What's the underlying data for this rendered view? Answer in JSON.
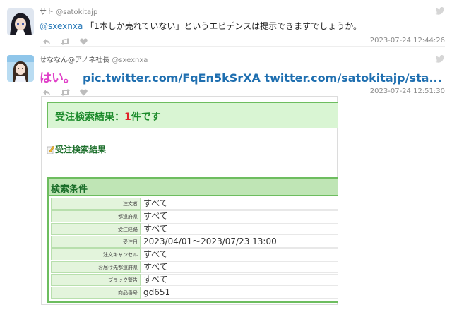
{
  "tweets": [
    {
      "display_name": "サト",
      "handle": "@satokitajp",
      "mention": "@sxexnxa",
      "text": " 「1本しか売れていない」というエビデンスは提示できますでしょうか。",
      "timestamp": "2023-07-24 12:44:26"
    },
    {
      "display_name": "せななん@アノネ社長",
      "handle": "@sxexnxa",
      "text_lead": "はい。",
      "links": "pic.twitter.com/FqEn5kSrXA twitter.com/satokitajp/sta...",
      "timestamp": "2023-07-24 12:51:30"
    }
  ],
  "embedded": {
    "banner_prefix": "受注検索結果：",
    "banner_count": "1",
    "banner_suffix": "件です",
    "subheading": "受注検索結果",
    "conditions_title": "検索条件",
    "rows": [
      {
        "label": "注文者",
        "value": "すべて"
      },
      {
        "label": "都道府県",
        "value": "すべて"
      },
      {
        "label": "受注経路",
        "value": "すべて"
      },
      {
        "label": "受注日",
        "value": "2023/04/01～2023/07/23 13:00"
      },
      {
        "label": "注文キャンセル",
        "value": "すべて"
      },
      {
        "label": "お届け先都道府県",
        "value": "すべて"
      },
      {
        "label": "ブラック警告",
        "value": "すべて"
      },
      {
        "label": "商品番号",
        "value": "gd651"
      }
    ]
  },
  "icons": {
    "reply": "reply-icon",
    "retweet": "retweet-icon",
    "like": "heart-icon",
    "platform": "twitter-bird-icon"
  },
  "colors": {
    "link": "#1f6fb0",
    "mention": "#2b7bb9",
    "highlight_text": "#e040c8",
    "banner_bg": "#d9f5d3",
    "banner_text": "#1b8a2a",
    "count": "#e0242a",
    "table_border": "#6dbd5f"
  }
}
